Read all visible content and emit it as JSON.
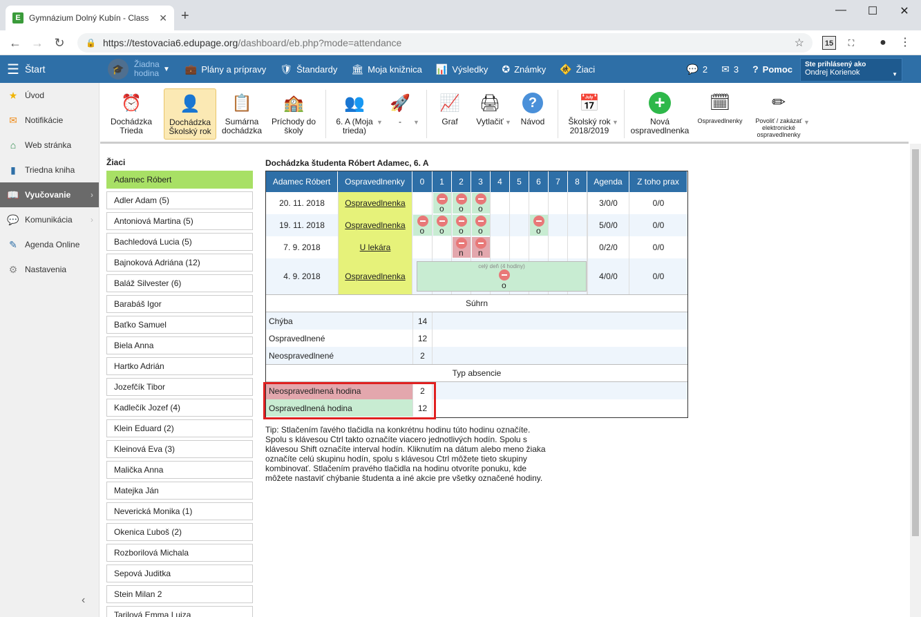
{
  "browser": {
    "tab_title": "Gymnázium Dolný Kubín - Class",
    "url_host": "https://testovacia6.edupage.org",
    "url_path": "/dashboard/eb.php?mode=attendance",
    "ext_badge": "15"
  },
  "topnav": {
    "menu": "Štart",
    "hodina": "Žiadna hodina",
    "items": [
      "Plány a prípravy",
      "Štandardy",
      "Moja knižnica",
      "Výsledky",
      "Známky",
      "Žiaci"
    ],
    "messages_count": "2",
    "mail_count": "3",
    "help": "Pomoc",
    "logged_as_label": "Ste prihlásený ako",
    "user_name": "Ondrej Korienok"
  },
  "sidebar": {
    "items": [
      "Úvod",
      "Notifikácie",
      "Web stránka",
      "Triedna kniha",
      "Vyučovanie",
      "Komunikácia",
      "Agenda Online",
      "Nastavenia"
    ]
  },
  "toolbar": {
    "items": [
      "Dochádzka Trieda",
      "Dochádzka Školský rok",
      "Sumárna dochádzka",
      "Príchody do školy",
      "6. A (Moja trieda)",
      "-",
      "Graf",
      "Vytlačiť",
      "Návod",
      "Školský rok 2018/2019",
      "Nová ospravedlnenka",
      "Ospravedlnenky",
      "Povoliť / zakázať elektronické ospravedlnenky"
    ]
  },
  "students": {
    "label": "Žiaci",
    "list": [
      "Adamec Róbert",
      "Adler Adam (5)",
      "Antoniová Martina (5)",
      "Bachledová Lucia (5)",
      "Bajnoková Adriána (12)",
      "Baláž Silvester (6)",
      "Barabáš Igor",
      "Baťko Samuel",
      "Biela Anna",
      "Hartko Adrián",
      "Jozefčík Tibor",
      "Kadlečík Jozef (4)",
      "Klein Eduard (2)",
      "Kleinová Eva (3)",
      "Malička Anna",
      "Matejka Ján",
      "Neverická Monika (1)",
      "Okenica Ľuboš (2)",
      "Rozborilová Michala",
      "Sepová Juditka",
      "Stein Milan 2",
      "Tarilová Emma Luiza"
    ]
  },
  "attendance": {
    "title": "Dochádzka študenta Róbert Adamec, 6. A",
    "headers": [
      "Adamec Róbert",
      "Ospravedlnenky",
      "0",
      "1",
      "2",
      "3",
      "4",
      "5",
      "6",
      "7",
      "8",
      "Agenda",
      "Z toho prax"
    ],
    "rows": [
      {
        "date": "20. 11. 2018",
        "excuse": "Ospravedlnenka",
        "agenda": "3/0/0",
        "prax": "0/0"
      },
      {
        "date": "19. 11. 2018",
        "excuse": "Ospravedlnenka",
        "agenda": "5/0/0",
        "prax": "0/0"
      },
      {
        "date": "7. 9. 2018",
        "excuse": "U lekára",
        "agenda": "0/2/0",
        "prax": "0/0"
      },
      {
        "date": "4. 9. 2018",
        "excuse": "Ospravedlnenka",
        "agenda": "4/0/0",
        "prax": "0/0"
      }
    ],
    "whole_day": "celý deň (4 hodiny)",
    "mark_o": "o",
    "mark_n": "n",
    "summary_title": "Súhrn",
    "summary": [
      {
        "label": "Chýba",
        "value": "14"
      },
      {
        "label": "Ospravedlnené",
        "value": "12"
      },
      {
        "label": "Neospravedlnené",
        "value": "2"
      }
    ],
    "type_title": "Typ absencie",
    "types": [
      {
        "label": "Neospravedlnená hodina",
        "value": "2",
        "color": "#e3a7ad"
      },
      {
        "label": "Ospravedlnená hodina",
        "value": "12",
        "color": "#c8ecd2"
      }
    ]
  },
  "tip": "Tip: Stlačením ľavého tlačidla na konkrétnu hodinu túto hodinu označíte. Spolu s klávesou Ctrl takto označíte viacero jednotlivých hodín. Spolu s klávesou Shift označíte interval hodín. Kliknutím na dátum alebo meno žiaka označíte celú skupinu hodín, spolu s klávesou Ctrl môžete tieto skupiny kombinovať. Stlačením pravého tlačidla na hodinu otvoríte ponuku, kde môžete nastaviť chýbanie študenta a iné akcie pre všetky označené hodiny."
}
